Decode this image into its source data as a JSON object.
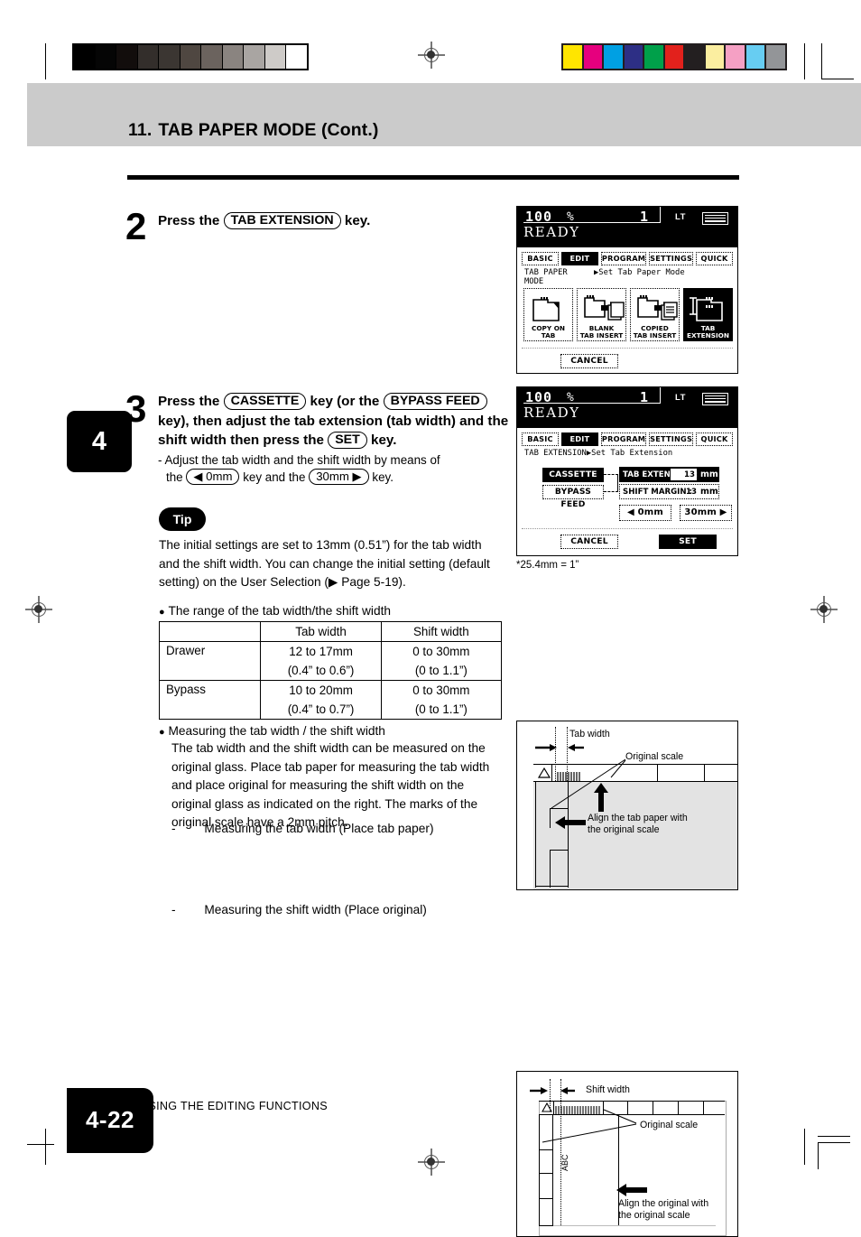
{
  "page": {
    "chapter_number": "11.",
    "chapter_title": "TAB PAPER MODE (Cont.)",
    "chapter_tab": "4",
    "page_number": "4-22",
    "footer_text": "USING THE EDITING FUNCTIONS"
  },
  "steps": [
    {
      "number": "2",
      "line1_a": "Press the",
      "key1": "TAB EXTENSION",
      "line1_b": "key."
    },
    {
      "number": "3",
      "line1_a": "Press the",
      "key_cassette": "CASSETTE",
      "line1_b": "key (or the",
      "key_bypass": "BYPASS FEED",
      "line2": "key), then adjust the tab extension (tab width) and",
      "line3_a": "the shift width then press the",
      "key_set": "SET",
      "line3_b": "key.",
      "sub_a": "- Adjust the tab width and the shift width by means of",
      "sub_b_pre": "the",
      "sub_key_minus": "◀ 0mm",
      "sub_b_mid": "key and the",
      "sub_key_plus": "30mm ▶",
      "sub_b_post": "key."
    }
  ],
  "tip": {
    "label": "Tip",
    "line1": "The initial settings are set to 13mm (0.51”) for the tab width",
    "line2": "and the shift width. You can change the initial setting (default",
    "line3_a": "setting) on the User Selection (",
    "line3_b": "Page 5-19)."
  },
  "range_section": {
    "heading": "The range of the tab width/the shift width",
    "columns": [
      "",
      "Tab width",
      "Shift width"
    ],
    "rows": [
      {
        "label": "Drawer",
        "tab_width": "12 to 17mm",
        "tab_width_inch": "(0.4” to 0.6”)",
        "shift_width": "0 to 30mm",
        "shift_width_inch": "(0 to 1.1”)"
      },
      {
        "label": "Bypass",
        "tab_width": "10 to 20mm",
        "tab_width_inch": "(0.4” to 0.7”)",
        "shift_width": "0 to 30mm",
        "shift_width_inch": "(0 to 1.1”)"
      }
    ]
  },
  "measuring_section": {
    "heading": "Measuring the tab width / the shift width",
    "para": [
      "The tab width and the shift width can be measured on the",
      "original glass. Place tab paper for measuring the tab width",
      "and place original for measuring the shift width on the",
      "original glass as indicated on the right. The marks of the",
      "original scale have a 2mm pitch."
    ],
    "item1_dash": "-",
    "item1": "Measuring the tab width (Place tab paper)",
    "item2_dash": "-",
    "item2": "Measuring the shift width (Place original)"
  },
  "unit_note": "*25.4mm = 1”",
  "lcd1": {
    "zoom": "100",
    "percent": "%",
    "copies": "1",
    "status": "READY",
    "paper_size": "LT",
    "tabs": [
      {
        "label": "BASIC",
        "selected": false
      },
      {
        "label": "EDIT",
        "selected": true
      },
      {
        "label": "PROGRAM",
        "selected": false
      },
      {
        "label": "SETTINGS",
        "selected": false
      },
      {
        "label": "QUICK",
        "selected": false
      }
    ],
    "breadcrumb_left_l1": "TAB PAPER",
    "breadcrumb_left_l2": "MODE",
    "breadcrumb_right": "▶Set Tab Paper Mode",
    "icons": [
      {
        "caption_l1": "COPY ON TAB",
        "caption_l2": "",
        "selected": false
      },
      {
        "caption_l1": "BLANK",
        "caption_l2": "TAB INSERT",
        "selected": false
      },
      {
        "caption_l1": "COPIED",
        "caption_l2": "TAB INSERT",
        "selected": false
      },
      {
        "caption_l1": "TAB",
        "caption_l2": "EXTENSION",
        "selected": true
      }
    ],
    "cancel": "CANCEL"
  },
  "lcd2": {
    "zoom": "100",
    "percent": "%",
    "copies": "1",
    "status": "READY",
    "paper_size": "LT",
    "tabs": [
      {
        "label": "BASIC",
        "selected": false
      },
      {
        "label": "EDIT",
        "selected": true
      },
      {
        "label": "PROGRAM",
        "selected": false
      },
      {
        "label": "SETTINGS",
        "selected": false
      },
      {
        "label": "QUICK",
        "selected": false
      }
    ],
    "breadcrumb_left": "TAB EXTENSION",
    "breadcrumb_right": "▶Set Tab Extension",
    "source_cassette": "CASSETTE",
    "source_bypass": "BYPASS FEED",
    "field_tab_label": "TAB EXTENSION :",
    "field_tab_value": "13",
    "field_tab_unit": "mm",
    "field_shift_label": "SHIFT MARGIN :",
    "field_shift_value": "13",
    "field_shift_unit": "mm",
    "btn_minus": "◀  0mm",
    "btn_plus": "30mm ▶",
    "cancel": "CANCEL",
    "set": "SET"
  },
  "illustration1": {
    "label_tab_width": "Tab width",
    "label_original_scale": "Original scale",
    "label_align_l1": "Align the tab paper with",
    "label_align_l2": "the original scale"
  },
  "illustration2": {
    "label_shift_width": "Shift width",
    "label_original_scale": "Original scale",
    "label_abc": "ABC",
    "label_align_l1": "Align the original with",
    "label_align_l2": "the original scale"
  },
  "calibration": {
    "grayscale": [
      "#000000",
      "#050505",
      "#120d0c",
      "#332e2b",
      "#3b3632",
      "#4f4741",
      "#6b635e",
      "#8a8480",
      "#a9a5a2",
      "#cecbc8",
      "#ffffff"
    ],
    "colors": [
      "#ffe500",
      "#e6007e",
      "#00a0e3",
      "#2d2f85",
      "#00a04a",
      "#e2211c",
      "#231f20",
      "#fbeea0",
      "#f5a0c4",
      "#67cdf2",
      "#939598"
    ]
  }
}
